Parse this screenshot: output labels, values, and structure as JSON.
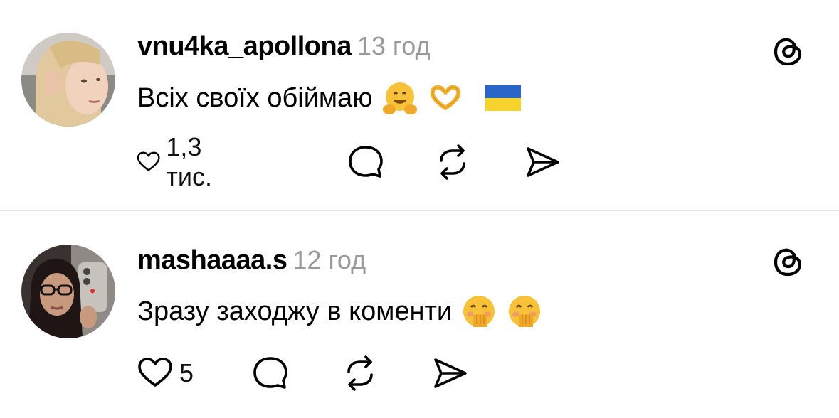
{
  "posts": [
    {
      "username": "vnu4ka_apollona",
      "time": "13 год",
      "text": "Всіх своїх обіймаю",
      "emojis": [
        "hugging-face-emoji",
        "heart-hands-emoji",
        "ukraine-flag-emoji"
      ],
      "likes": "1,3 тис.",
      "avatar": "woman-blonde-avatar"
    },
    {
      "username": "mashaaaa.s",
      "time": "12 год",
      "text": "Зразу заходжу в коменти",
      "emojis": [
        "face-with-hand-over-mouth-emoji",
        "face-with-hand-over-mouth-emoji"
      ],
      "likes": "5",
      "avatar": "woman-dark-hair-glasses-avatar"
    }
  ],
  "icons": {
    "like": "heart-icon",
    "comment": "comment-bubble-icon",
    "repost": "repost-icon",
    "share": "send-icon",
    "menu": "threads-logo-icon"
  },
  "colors": {
    "text": "#000000",
    "muted": "#9a9a9a",
    "divider": "#e4e4e4"
  }
}
